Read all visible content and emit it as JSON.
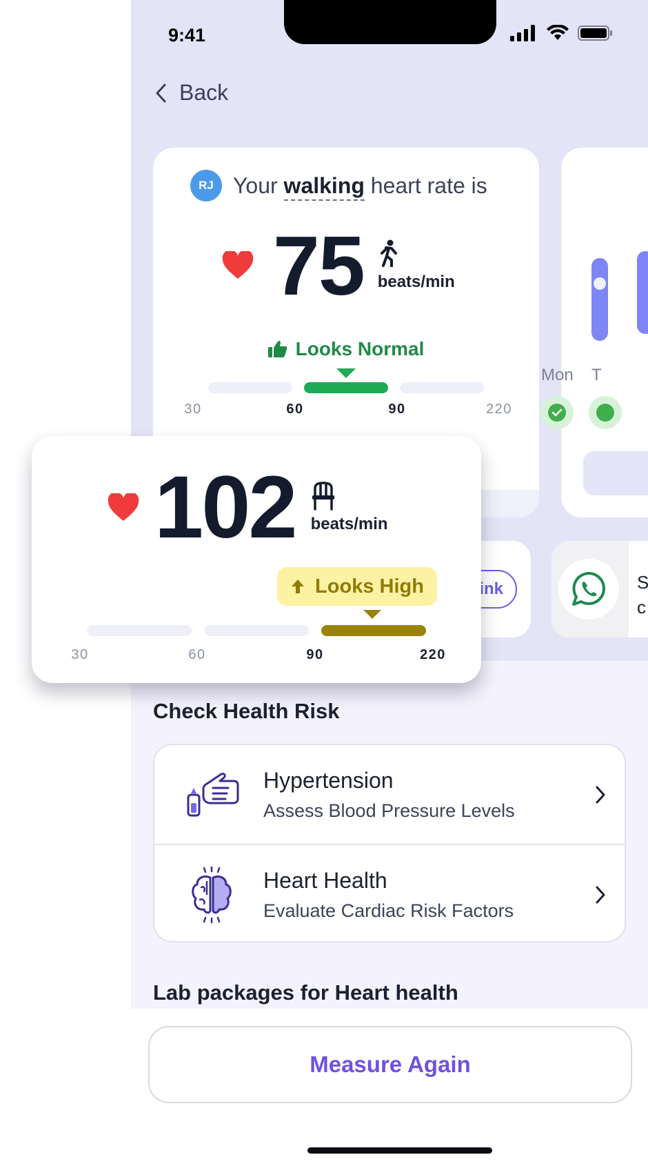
{
  "status_bar": {
    "time": "9:41"
  },
  "nav": {
    "back_label": "Back"
  },
  "heart_card": {
    "avatar_initials": "RJ",
    "title_prefix": "Your",
    "title_activity": "walking",
    "title_suffix": "heart rate is",
    "bpm": "75",
    "unit": "beats/min",
    "status": "Looks Normal",
    "scale_ticks": [
      "30",
      "60",
      "90",
      "220"
    ]
  },
  "side_card": {
    "day_1": "Mon",
    "day_2": "T"
  },
  "share_row": {
    "link_label": "Link",
    "whatsapp_text_1": "S",
    "whatsapp_text_2": "c"
  },
  "overlay_card": {
    "bpm": "102",
    "unit": "beats/min",
    "status": "Looks High",
    "scale_ticks": [
      "30",
      "60",
      "90",
      "220"
    ]
  },
  "health_risk": {
    "section_title": "Check Health Risk",
    "items": [
      {
        "title": "Hypertension",
        "subtitle": "Assess Blood Pressure Levels",
        "icon": "blood-pressure-icon"
      },
      {
        "title": "Heart Health",
        "subtitle": "Evaluate Cardiac Risk Factors",
        "icon": "brain-icon"
      }
    ]
  },
  "lab_section_title": "Lab packages for Heart health",
  "measure_button": "Measure Again",
  "colors": {
    "accent": "#6e52e0",
    "normal": "#1faa56",
    "high": "#9b8305",
    "high_bg": "#fdf1a4",
    "background": "#e4e4f7"
  }
}
